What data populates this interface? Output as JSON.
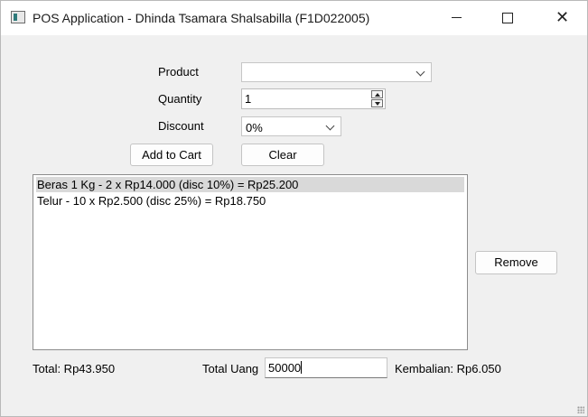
{
  "window": {
    "title": "POS Application - Dhinda Tsamara Shalsabilla (F1D022005)",
    "min_glyph": "—",
    "close_glyph": "✕"
  },
  "form": {
    "product_label": "Product",
    "product_value": "",
    "quantity_label": "Quantity",
    "quantity_value": "1",
    "discount_label": "Discount",
    "discount_value": "0%",
    "add_to_cart_label": "Add to Cart",
    "clear_label": "Clear"
  },
  "cart": {
    "items": [
      "Beras 1 Kg - 2 x Rp14.000 (disc 10%) = Rp25.200",
      "Telur - 10 x Rp2.500 (disc 25%) = Rp18.750"
    ],
    "selected_index": 0,
    "remove_label": "Remove"
  },
  "footer": {
    "total": "Total: Rp43.950",
    "total_uang_label": "Total Uang",
    "total_uang_value": "50000",
    "kembalian": "Kembalian: Rp6.050"
  }
}
